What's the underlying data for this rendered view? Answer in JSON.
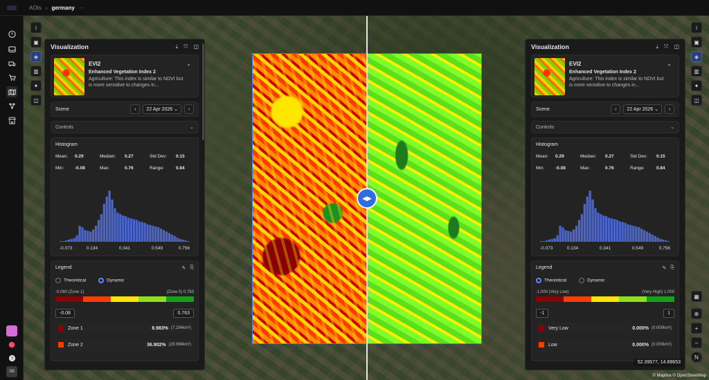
{
  "breadcrumb": {
    "root": "AOIs",
    "current": "germany",
    "more": "···"
  },
  "user": {
    "initials": "SB"
  },
  "left_panel": {
    "title": "Visualization",
    "layer": {
      "name": "EVI2",
      "full_name": "Enhanced Vegetation Index 2",
      "description": "Agriculture: This index is similar to NDVI but is more sensitive to changes in..."
    },
    "scene": {
      "label": "Scene",
      "date": "22 Apr 2026"
    },
    "controls_label": "Controls",
    "histogram": {
      "label": "Histogram",
      "mean_label": "Mean:",
      "mean": "0.29",
      "median_label": "Median:",
      "median": "0.27",
      "std_label": "Std Dev:",
      "std": "0.15",
      "min_label": "Min:",
      "min": "-0.08",
      "max_label": "Max:",
      "max": "0.76",
      "range_label": "Range:",
      "range": "0.84",
      "ticks": [
        "-0.073",
        "0.134",
        "0.341",
        "0.549",
        "0.756"
      ]
    },
    "legend": {
      "label": "Legend",
      "mode_theoretical": "Theoretical",
      "mode_dynamic": "Dynamic",
      "range_low": "-0.080 (Zone 1)",
      "range_high": "(Zone 5) 0.763",
      "min_input": "-0.08",
      "max_input": "0.763",
      "zones": [
        {
          "name": "Zone 1",
          "pct": "8.983%",
          "area": "(7.294km²)",
          "color": "#8b0000"
        },
        {
          "name": "Zone 2",
          "pct": "36.902%",
          "area": "(29.966km²)",
          "color": "#ff3c00"
        }
      ]
    }
  },
  "right_panel": {
    "title": "Visualization",
    "layer": {
      "name": "EVI2",
      "full_name": "Enhanced Vegetation Index 2",
      "description": "Agriculture: This index is similar to NDVI but is more sensitive to changes in..."
    },
    "scene": {
      "label": "Scene",
      "date": "22 Apr 2026"
    },
    "controls_label": "Controls",
    "histogram": {
      "label": "Histogram",
      "mean_label": "Mean:",
      "mean": "0.29",
      "median_label": "Median:",
      "median": "0.27",
      "std_label": "Std Dev:",
      "std": "0.15",
      "min_label": "Min:",
      "min": "-0.08",
      "max_label": "Max:",
      "max": "0.76",
      "range_label": "Range:",
      "range": "0.84",
      "ticks": [
        "-0.073",
        "0.134",
        "0.341",
        "0.549",
        "0.756"
      ]
    },
    "legend": {
      "label": "Legend",
      "mode_theoretical": "Theoretical",
      "mode_dynamic": "Dynamic",
      "range_low": "-1.000 (Very Low)",
      "range_high": "(Very High) 1.000",
      "min_input": "-1",
      "max_input": "1",
      "zones": [
        {
          "name": "Very Low",
          "pct": "0.000%",
          "area": "(0.000km²)",
          "color": "#8b0000"
        },
        {
          "name": "Low",
          "pct": "0.000%",
          "area": "(0.000km²)",
          "color": "#ff3c00"
        }
      ]
    }
  },
  "legend_colors": [
    "#8b0000",
    "#ff3c00",
    "#ffe600",
    "#8fe01a",
    "#1a9e1a"
  ],
  "histogram_bars": [
    1,
    1,
    2,
    3,
    4,
    5,
    9,
    22,
    20,
    16,
    15,
    14,
    17,
    22,
    30,
    38,
    52,
    62,
    70,
    58,
    46,
    40,
    38,
    36,
    35,
    33,
    32,
    31,
    30,
    28,
    27,
    26,
    24,
    23,
    22,
    21,
    20,
    18,
    16,
    14,
    12,
    10,
    8,
    6,
    4,
    3,
    2,
    1
  ],
  "map": {
    "coords": "52.39577, 14.89653",
    "attribution": "© Mapbox © OpenStreetMap",
    "compass": "N",
    "zoom_in": "+",
    "zoom_out": "−"
  }
}
